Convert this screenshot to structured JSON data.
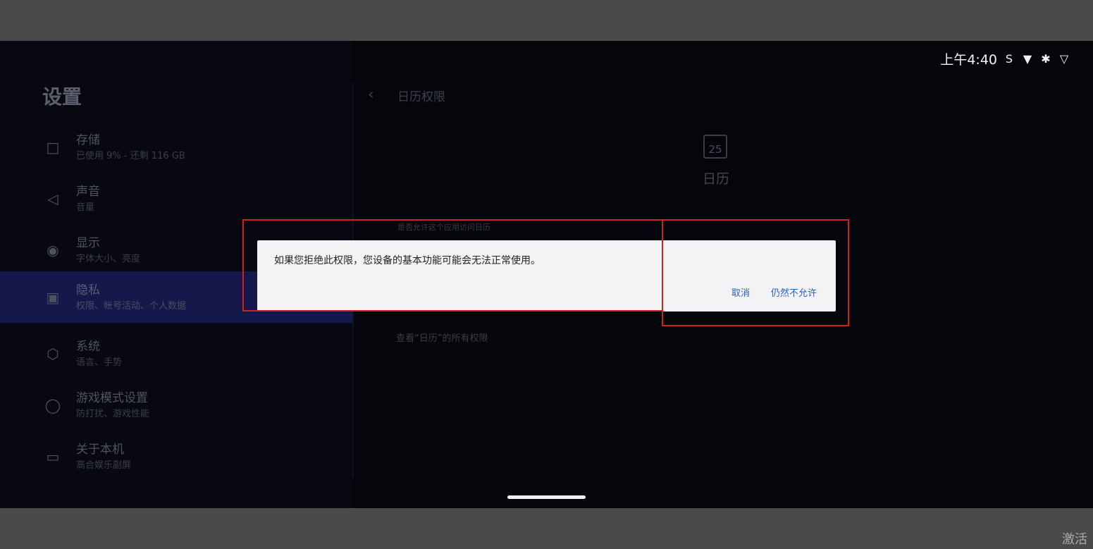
{
  "status_bar": {
    "time": "上午4:40",
    "icons": [
      "sim-icon",
      "wifi-icon",
      "bluetooth-icon",
      "signal-icon"
    ]
  },
  "sidebar": {
    "title": "设置",
    "items": [
      {
        "label": "存储",
        "sub": "已使用 9% - 还剩 116 GB",
        "icon": "storage-icon"
      },
      {
        "label": "声音",
        "sub": "音量",
        "icon": "sound-icon"
      },
      {
        "label": "显示",
        "sub": "字体大小、亮度",
        "icon": "eye-icon"
      },
      {
        "label": "隐私",
        "sub": "权限、帐号活动、个人数据",
        "icon": "privacy-icon",
        "selected": true
      },
      {
        "label": "系统",
        "sub": "语言、手势",
        "icon": "system-icon"
      },
      {
        "label": "游戏模式设置",
        "sub": "防打扰、游戏性能",
        "icon": "gamepad-icon"
      },
      {
        "label": "关于本机",
        "sub": "高合娱乐副屏",
        "icon": "display-icon"
      }
    ]
  },
  "main": {
    "title": "日历权限",
    "app_icon_text": "25",
    "app_name": "日历",
    "question": "是否允许这个应用访问日历",
    "view_all": "查看“日历”的所有权限"
  },
  "dialog": {
    "message": "如果您拒绝此权限，您设备的基本功能可能会无法正常使用。",
    "cancel_label": "取消",
    "deny_label": "仍然不允许"
  },
  "watermark": "激活",
  "colors": {
    "accent_button": "#2a5ec0",
    "selected_bg": "#15184a",
    "highlight_box": "#d21f1f"
  }
}
